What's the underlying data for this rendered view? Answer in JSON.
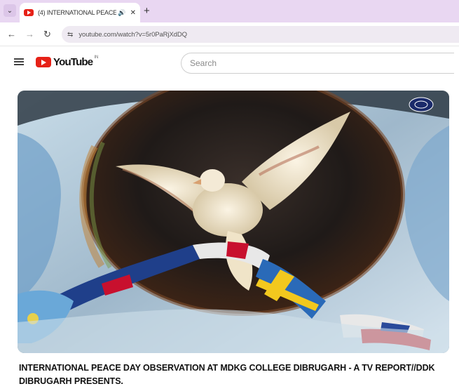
{
  "browser": {
    "tab": {
      "title": "(4) INTERNATIONAL PEACE",
      "audio_icon": "speaker-icon",
      "close_glyph": "✕"
    },
    "new_tab_glyph": "+",
    "tab_menu_glyph": "⌄",
    "back_glyph": "←",
    "forward_glyph": "→",
    "reload_glyph": "↻",
    "site_info_glyph": "⇆",
    "url": "youtube.com/watch?v=5r0PaRjXdDQ"
  },
  "youtube": {
    "logo_text": "YouTube",
    "country_code": "IN",
    "search_placeholder": "Search"
  },
  "video": {
    "title": "INTERNATIONAL PEACE DAY OBSERVATION AT MDKG COLLEGE DIBRUGARH - A TV REPORT//DDK DIBRUGARH PRESENTS.",
    "thumbnail": "painting of a white dove carrying national flags over a dark globe",
    "channel_badge": "DD logo"
  }
}
